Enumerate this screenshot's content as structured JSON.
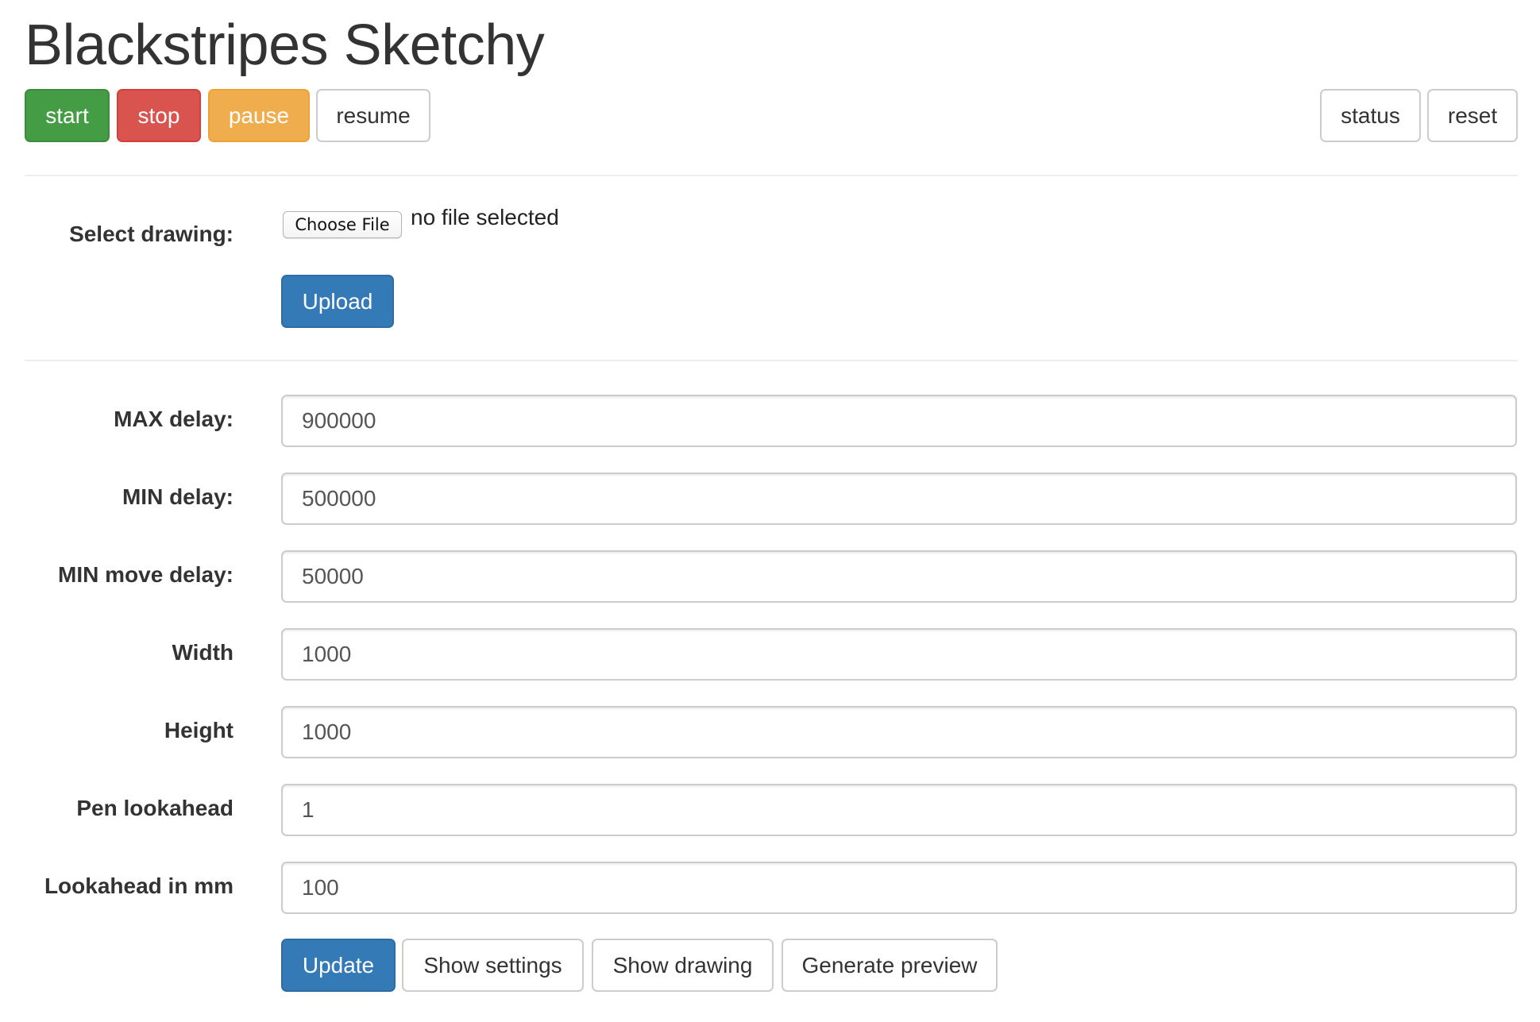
{
  "header": {
    "title": "Blackstripes Sketchy"
  },
  "controls": {
    "start": "start",
    "stop": "stop",
    "pause": "pause",
    "resume": "resume",
    "status": "status",
    "reset": "reset"
  },
  "upload": {
    "label": "Select drawing:",
    "choose_file": "Choose File",
    "file_status": "no file selected",
    "upload_button": "Upload"
  },
  "settings": {
    "fields": [
      {
        "label": "MAX delay:",
        "value": "900000"
      },
      {
        "label": "MIN delay:",
        "value": "500000"
      },
      {
        "label": "MIN move delay:",
        "value": "50000"
      },
      {
        "label": "Width",
        "value": "1000"
      },
      {
        "label": "Height",
        "value": "1000"
      },
      {
        "label": "Pen lookahead",
        "value": "1"
      },
      {
        "label": "Lookahead in mm",
        "value": "100"
      }
    ],
    "actions": {
      "update": "Update",
      "show_settings": "Show settings",
      "show_drawing": "Show drawing",
      "generate_preview": "Generate preview"
    }
  },
  "colors": {
    "success": "#449d44",
    "danger": "#d9534f",
    "warning": "#f0ad4e",
    "primary": "#337ab7",
    "text": "#333333"
  }
}
